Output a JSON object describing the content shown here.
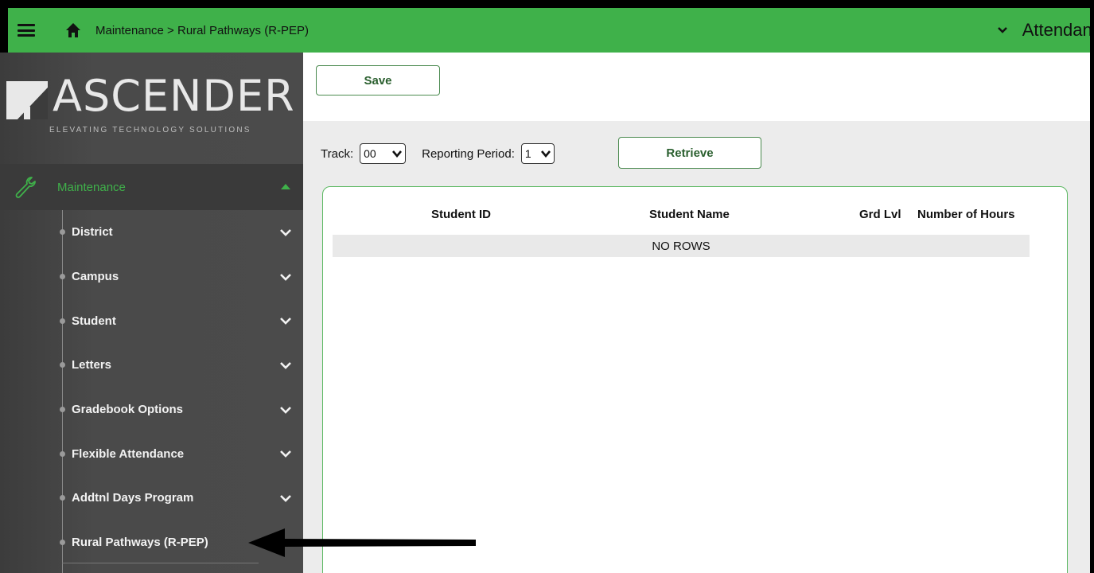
{
  "header": {
    "breadcrumb": "Maintenance > Rural Pathways (R-PEP)",
    "app_name": "Attendance",
    "accent_color": "#3fb14a"
  },
  "logo": {
    "name": "ASCENDER",
    "tagline": "ELEVATING TECHNOLOGY SOLUTIONS"
  },
  "sidebar": {
    "section_label": "Maintenance",
    "section_icon": "wrench-icon",
    "items": [
      {
        "label": "District"
      },
      {
        "label": "Campus"
      },
      {
        "label": "Student"
      },
      {
        "label": "Letters"
      },
      {
        "label": "Gradebook Options"
      },
      {
        "label": "Flexible Attendance"
      },
      {
        "label": "Addtnl Days Program"
      },
      {
        "label": "Rural Pathways (R-PEP)"
      }
    ]
  },
  "toolbar": {
    "save_label": "Save"
  },
  "filters": {
    "track_label": "Track:",
    "track_value": "00",
    "reporting_period_label": "Reporting Period:",
    "reporting_period_value": "1",
    "retrieve_label": "Retrieve"
  },
  "table": {
    "columns": [
      "Student ID",
      "Student Name",
      "Grd Lvl",
      "Number of Hours"
    ],
    "empty_text": "NO ROWS"
  }
}
